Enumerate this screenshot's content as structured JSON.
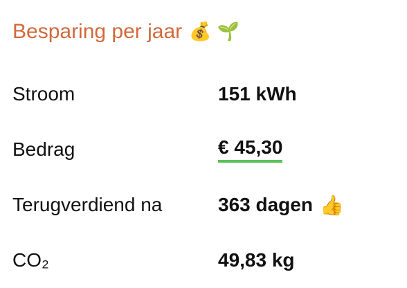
{
  "header": {
    "title": "Besparing per jaar",
    "money_bag_emoji": "💰",
    "sprout_emoji": "🌱"
  },
  "rows": [
    {
      "label": "Stroom",
      "value": "151 kWh"
    },
    {
      "label": "Bedrag",
      "value": "€ 45,30"
    },
    {
      "label": "Terugverdiend na",
      "value": "363 dagen",
      "emoji": "👍"
    },
    {
      "label": "CO₂",
      "value": "49,83 kg"
    }
  ],
  "colors": {
    "title": "#d2693b",
    "underline": "#5bc25a",
    "text": "#111111"
  }
}
